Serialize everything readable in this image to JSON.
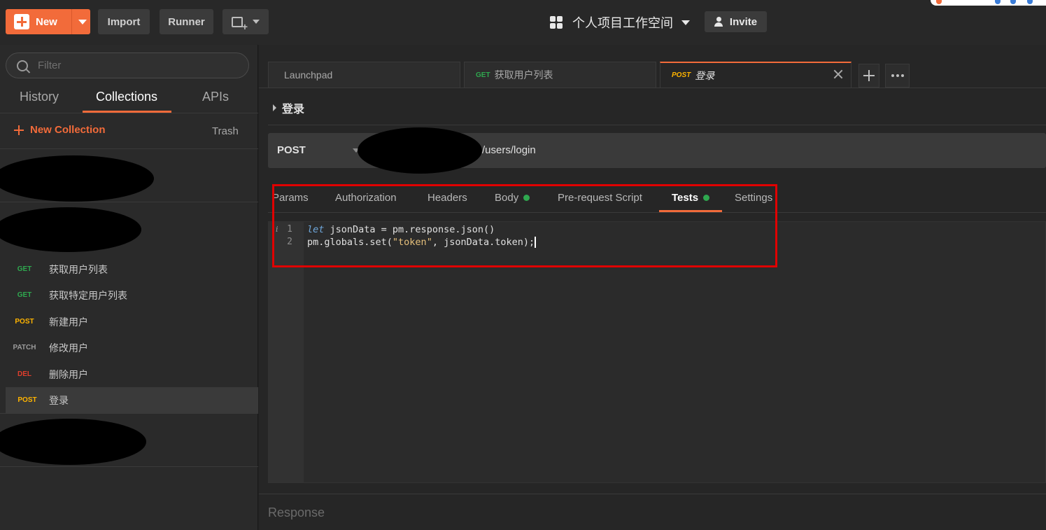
{
  "topbar": {
    "new_label": "New",
    "import_label": "Import",
    "runner_label": "Runner",
    "workspace_name": "个人项目工作空间",
    "invite_label": "Invite"
  },
  "sidebar": {
    "filter_placeholder": "Filter",
    "tabs": {
      "history": "History",
      "collections": "Collections",
      "apis": "APIs"
    },
    "new_collection_label": "New Collection",
    "trash_label": "Trash",
    "requests": [
      {
        "method": "GET",
        "name": "获取用户列表"
      },
      {
        "method": "GET",
        "name": "获取特定用户列表"
      },
      {
        "method": "POST",
        "name": "新建用户"
      },
      {
        "method": "PATCH",
        "name": "修改用户"
      },
      {
        "method": "DEL",
        "name": "删除用户"
      },
      {
        "method": "POST",
        "name": "登录"
      }
    ]
  },
  "tabs": [
    {
      "method": "",
      "label": "Launchpad"
    },
    {
      "method": "GET",
      "label": "获取用户列表"
    },
    {
      "method": "POST",
      "label": "登录"
    }
  ],
  "request": {
    "title": "登录",
    "method": "POST",
    "url_suffix": "/users/login",
    "subtabs": {
      "params": "Params",
      "authorization": "Authorization",
      "headers": "Headers",
      "body": "Body",
      "prerequest": "Pre-request Script",
      "tests": "Tests",
      "settings": "Settings"
    },
    "code_lines": [
      {
        "no": "1",
        "keyword": "let",
        "rest": " jsonData = pm.response.json()"
      },
      {
        "no": "2",
        "before": "pm.globals.set(",
        "string": "\"token\"",
        "after": ", jsonData.token);"
      }
    ]
  },
  "response": {
    "label": "Response"
  },
  "colors": {
    "accent": "#f26b3a",
    "get": "#2fa84f",
    "post": "#ffb400",
    "del": "#e03e2d",
    "highlight": "#e00000"
  }
}
